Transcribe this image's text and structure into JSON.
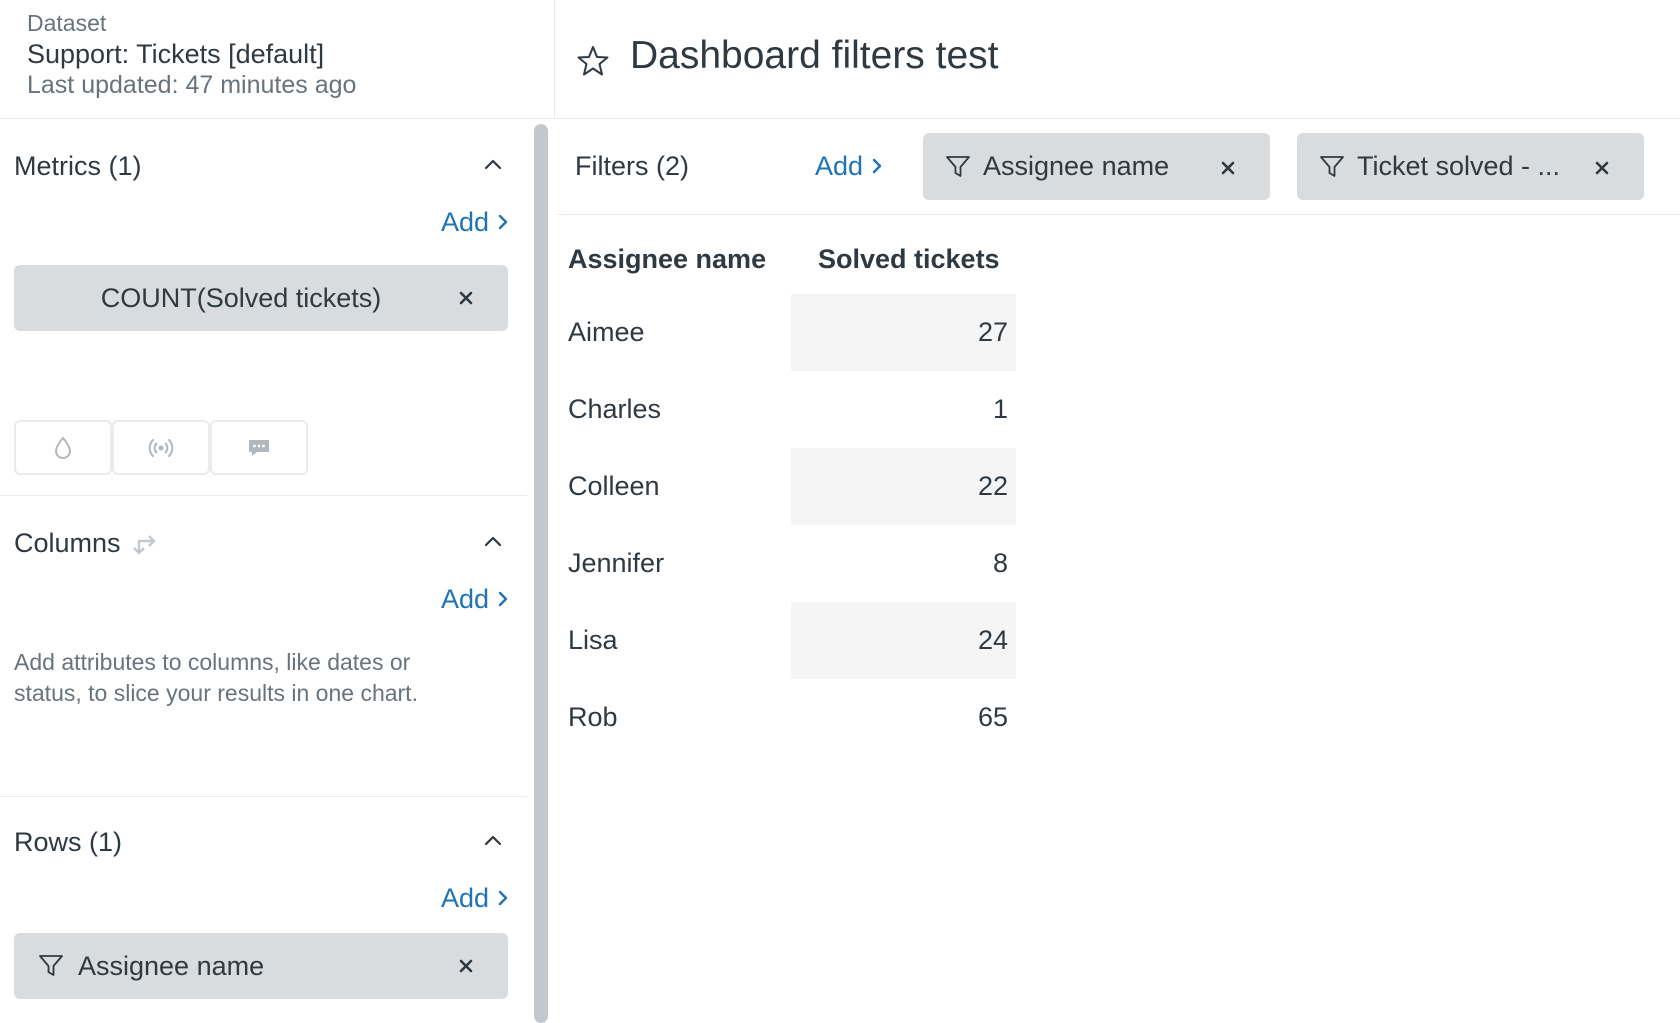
{
  "dataset": {
    "label": "Dataset",
    "name": "Support: Tickets [default]",
    "updated": "Last updated: 47 minutes ago"
  },
  "metrics": {
    "title": "Metrics (1)",
    "add_label": "Add",
    "pill_label": "COUNT(Solved tickets)",
    "viz_icons": [
      "drop-icon",
      "broadcast-icon",
      "chat-bubble-icon"
    ]
  },
  "columns": {
    "title": "Columns",
    "add_label": "Add",
    "hint": "Add attributes to columns, like dates or status, to slice your results in one chart."
  },
  "rows": {
    "title": "Rows (1)",
    "add_label": "Add",
    "pill_label": "Assignee name"
  },
  "header": {
    "title": "Dashboard filters test"
  },
  "filters": {
    "label": "Filters (2)",
    "add_label": "Add",
    "items": [
      "Assignee name",
      "Ticket solved - ..."
    ]
  },
  "table": {
    "headers": [
      "Assignee name",
      "Solved tickets"
    ],
    "rows": [
      {
        "name": "Aimee",
        "value": "27"
      },
      {
        "name": "Charles",
        "value": "1"
      },
      {
        "name": "Colleen",
        "value": "22"
      },
      {
        "name": "Jennifer",
        "value": "8"
      },
      {
        "name": "Lisa",
        "value": "24"
      },
      {
        "name": "Rob",
        "value": "65"
      }
    ]
  },
  "colors": {
    "accent": "#1f73b7",
    "pill_bg": "#d8dcde",
    "row_shade": "#f5f5f5"
  }
}
